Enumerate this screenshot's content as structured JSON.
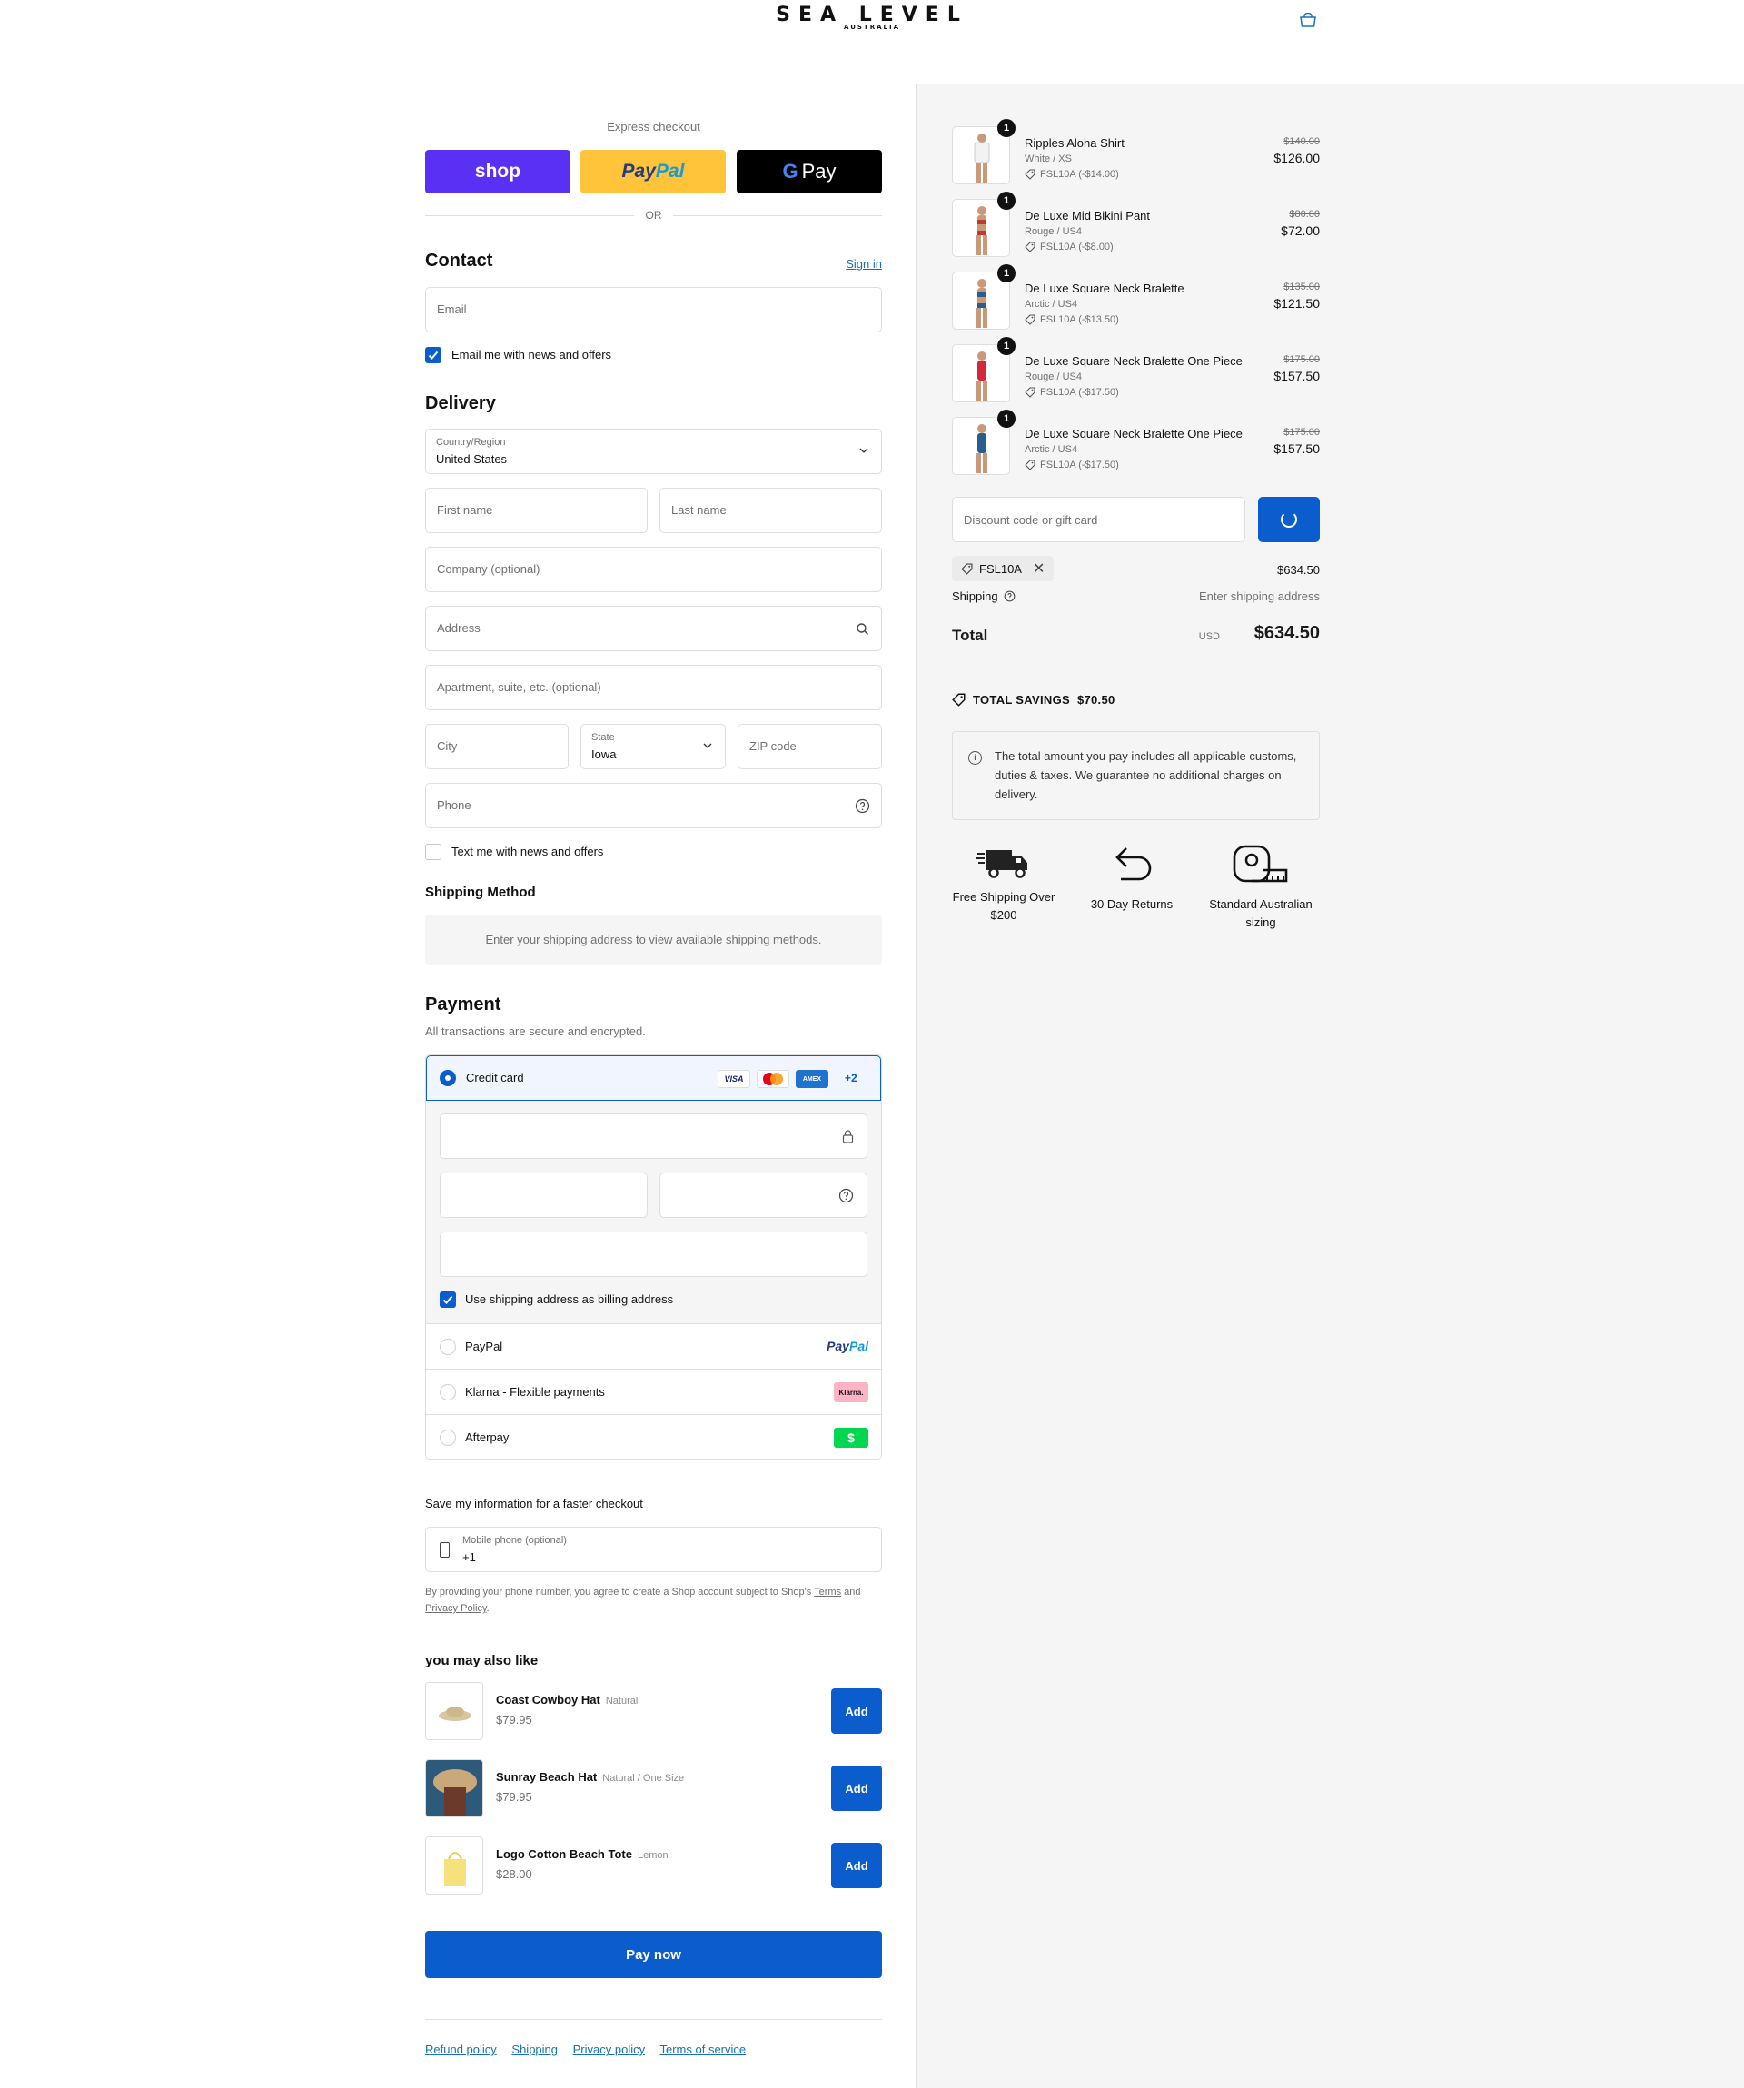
{
  "header": {
    "brand": "SEA LEVEL",
    "brand_sub": "AUSTRALIA"
  },
  "express": {
    "label": "Express checkout",
    "shop_label": "shop",
    "paypal_a": "Pay",
    "paypal_b": "Pal",
    "gpay_g": "G",
    "gpay_label": "Pay",
    "or": "OR"
  },
  "contact": {
    "title": "Contact",
    "sign_in": "Sign in",
    "email_placeholder": "Email",
    "news_label": "Email me with news and offers"
  },
  "delivery": {
    "title": "Delivery",
    "country_label": "Country/Region",
    "country_value": "United States",
    "first_name": "First name",
    "last_name": "Last name",
    "company": "Company (optional)",
    "address": "Address",
    "apartment": "Apartment, suite, etc. (optional)",
    "city": "City",
    "state_label": "State",
    "state_value": "Iowa",
    "zip": "ZIP code",
    "phone": "Phone",
    "text_label": "Text me with news and offers"
  },
  "shipping_method": {
    "title": "Shipping Method",
    "note": "Enter your shipping address to view available shipping methods."
  },
  "payment": {
    "title": "Payment",
    "subtitle": "All transactions are secure and encrypted.",
    "credit_card": "Credit card",
    "card_logos": [
      "VISA",
      "MC",
      "AMEX"
    ],
    "more": "+2",
    "billing_label": "Use shipping address as billing address",
    "paypal": "PayPal",
    "paypal_logo_a": "Pay",
    "paypal_logo_b": "Pal",
    "klarna": "Klarna - Flexible payments",
    "klarna_logo": "Klarna.",
    "afterpay": "Afterpay",
    "afterpay_logo": "$"
  },
  "save_info": {
    "title": "Save my information for a faster checkout",
    "phone_label": "Mobile phone (optional)",
    "phone_value": "+1",
    "legal_a": "By providing your phone number, you agree to create a Shop account subject to Shop's",
    "terms": "Terms",
    "legal_and": "and",
    "privacy": "Privacy Policy",
    "legal_end": "."
  },
  "recommendations": {
    "title": "you may also like",
    "add_label": "Add",
    "items": [
      {
        "name": "Coast Cowboy Hat",
        "variant": "Natural",
        "price": "$79.95"
      },
      {
        "name": "Sunray Beach Hat",
        "variant": "Natural / One Size",
        "price": "$79.95"
      },
      {
        "name": "Logo Cotton Beach Tote",
        "variant": "Lemon",
        "price": "$28.00"
      }
    ]
  },
  "pay_now": "Pay now",
  "footer_links": [
    "Refund policy",
    "Shipping",
    "Privacy policy",
    "Terms of service"
  ],
  "summary": {
    "items": [
      {
        "qty": "1",
        "name": "Ripples Aloha Shirt",
        "variant": "White / XS",
        "discount": "FSL10A (-$14.00)",
        "old_price": "$140.00",
        "price": "$126.00"
      },
      {
        "qty": "1",
        "name": "De Luxe Mid Bikini Pant",
        "variant": "Rouge / US4",
        "discount": "FSL10A (-$8.00)",
        "old_price": "$80.00",
        "price": "$72.00"
      },
      {
        "qty": "1",
        "name": "De Luxe Square Neck Bralette",
        "variant": "Arctic / US4",
        "discount": "FSL10A (-$13.50)",
        "old_price": "$135.00",
        "price": "$121.50"
      },
      {
        "qty": "1",
        "name": "De Luxe Square Neck Bralette One Piece",
        "variant": "Rouge / US4",
        "discount": "FSL10A (-$17.50)",
        "old_price": "$175.00",
        "price": "$157.50"
      },
      {
        "qty": "1",
        "name": "De Luxe Square Neck Bralette One Piece",
        "variant": "Arctic / US4",
        "discount": "FSL10A (-$17.50)",
        "old_price": "$175.00",
        "price": "$157.50"
      }
    ],
    "discount_placeholder": "Discount code or gift card",
    "applied_code": "FSL10A",
    "subtotal": "$634.50",
    "shipping_label": "Shipping",
    "shipping_value": "Enter shipping address",
    "total_label": "Total",
    "currency": "USD",
    "total": "$634.50",
    "savings_label": "TOTAL SAVINGS",
    "savings_value": "$70.50",
    "notice": "The total amount you pay includes all applicable customs, duties & taxes. We guarantee no additional charges on delivery.",
    "notice_icon": "i",
    "perks": [
      {
        "icon": "truck-icon",
        "label": "Free Shipping Over $200"
      },
      {
        "icon": "return-arrow-icon",
        "label": "30 Day Returns"
      },
      {
        "icon": "measuring-tape-icon",
        "label": "Standard Australian sizing"
      }
    ]
  },
  "colors": {
    "accent": "#0b5ccc",
    "shop": "#5a31f4",
    "paypal": "#ffc439",
    "summary_bg": "#f5f5f5"
  }
}
